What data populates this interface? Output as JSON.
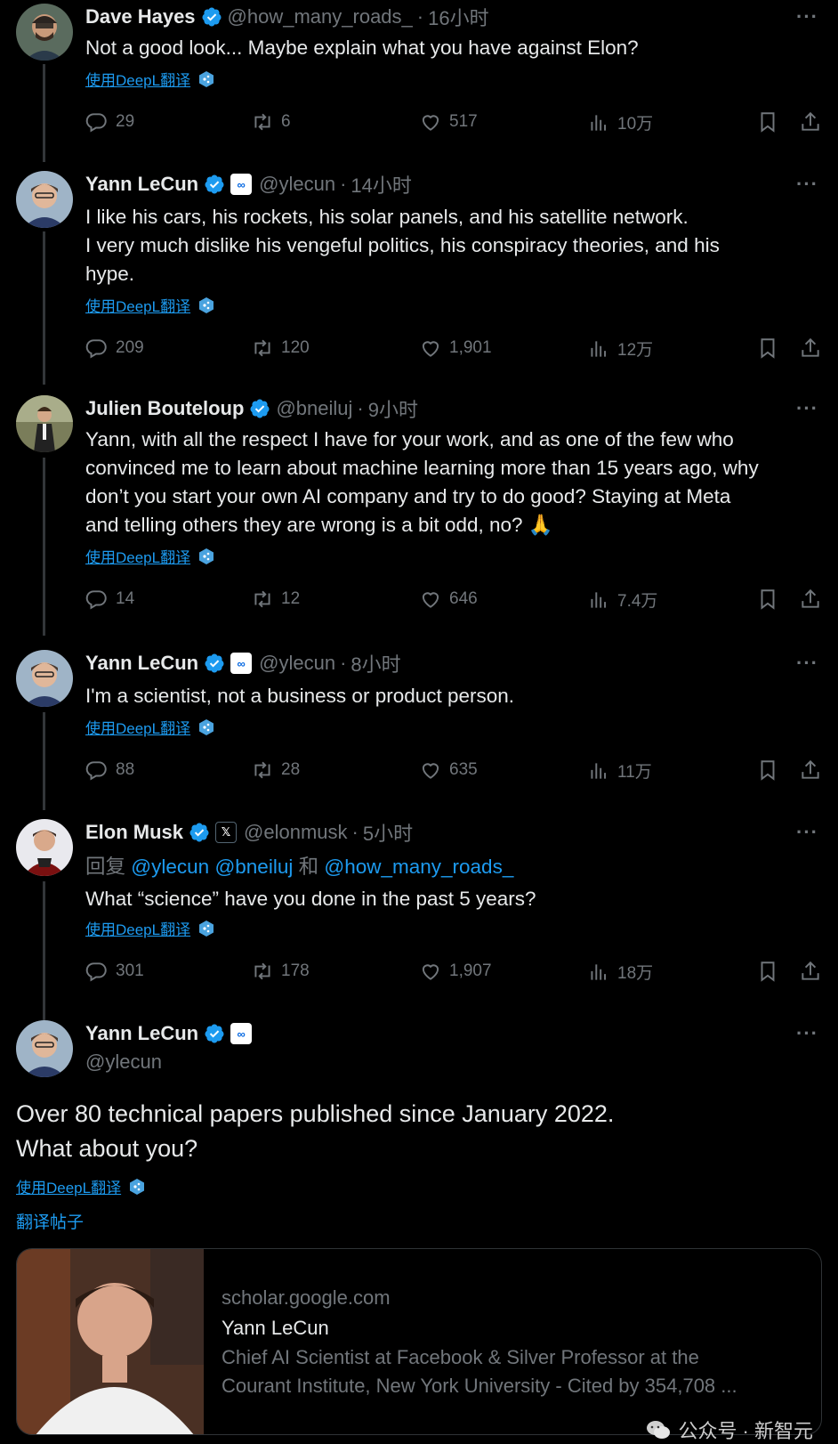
{
  "translate_label": "使用DeepL翻译",
  "tweets": [
    {
      "name": "Dave Hayes",
      "handle": "@how_many_roads_",
      "time": "16小时",
      "lines": [
        "Not a good look... Maybe explain what you have against Elon?"
      ],
      "stats": {
        "replies": "29",
        "retweets": "6",
        "likes": "517",
        "views": "10万"
      }
    },
    {
      "name": "Yann LeCun",
      "handle": "@ylecun",
      "time": "14小时",
      "lines": [
        "I like his cars, his rockets, his solar panels, and his satellite network.",
        "I very much dislike his vengeful politics, his conspiracy theories, and his",
        "hype."
      ],
      "stats": {
        "replies": "209",
        "retweets": "120",
        "likes": "1,901",
        "views": "12万"
      }
    },
    {
      "name": "Julien Bouteloup",
      "handle": "@bneiluj",
      "time": "9小时",
      "lines": [
        "Yann, with all the respect I have for your work, and as one of the few who",
        "convinced me to learn about machine learning more than 15 years ago, why",
        "don’t you start your own AI company and try to do good? Staying at Meta",
        "and telling others they are wrong is a bit odd, no? 🙏"
      ],
      "stats": {
        "replies": "14",
        "retweets": "12",
        "likes": "646",
        "views": "7.4万"
      }
    },
    {
      "name": "Yann LeCun",
      "handle": "@ylecun",
      "time": "8小时",
      "lines": [
        "I'm a scientist, not a business or product person."
      ],
      "stats": {
        "replies": "88",
        "retweets": "28",
        "likes": "635",
        "views": "11万"
      }
    },
    {
      "name": "Elon Musk",
      "handle": "@elonmusk",
      "time": "5小时",
      "reply_prefix": "回复",
      "reply_mentions": [
        "@ylecun",
        "@bneiluj",
        "@how_many_roads_"
      ],
      "reply_and": "和",
      "lines": [
        "What “science” have you done in the past 5 years?"
      ],
      "stats": {
        "replies": "301",
        "retweets": "178",
        "likes": "1,907",
        "views": "18万"
      }
    }
  ],
  "main": {
    "name": "Yann LeCun",
    "handle": "@ylecun",
    "line1": "Over 80 technical papers published since January 2022.",
    "line2": "What about you?",
    "translate_post": "翻译帖子",
    "card": {
      "domain": "scholar.google.com",
      "title": "Yann LeCun",
      "desc1": "Chief AI Scientist at Facebook & Silver Professor at the",
      "desc2": "Courant Institute, New York University - Cited by 354,708 ..."
    }
  },
  "watermark": "公众号 · 新智元",
  "colors": {
    "link": "#1d9bf0",
    "muted": "#71767b",
    "verified": "#1d9bf0",
    "background": "#000000"
  }
}
